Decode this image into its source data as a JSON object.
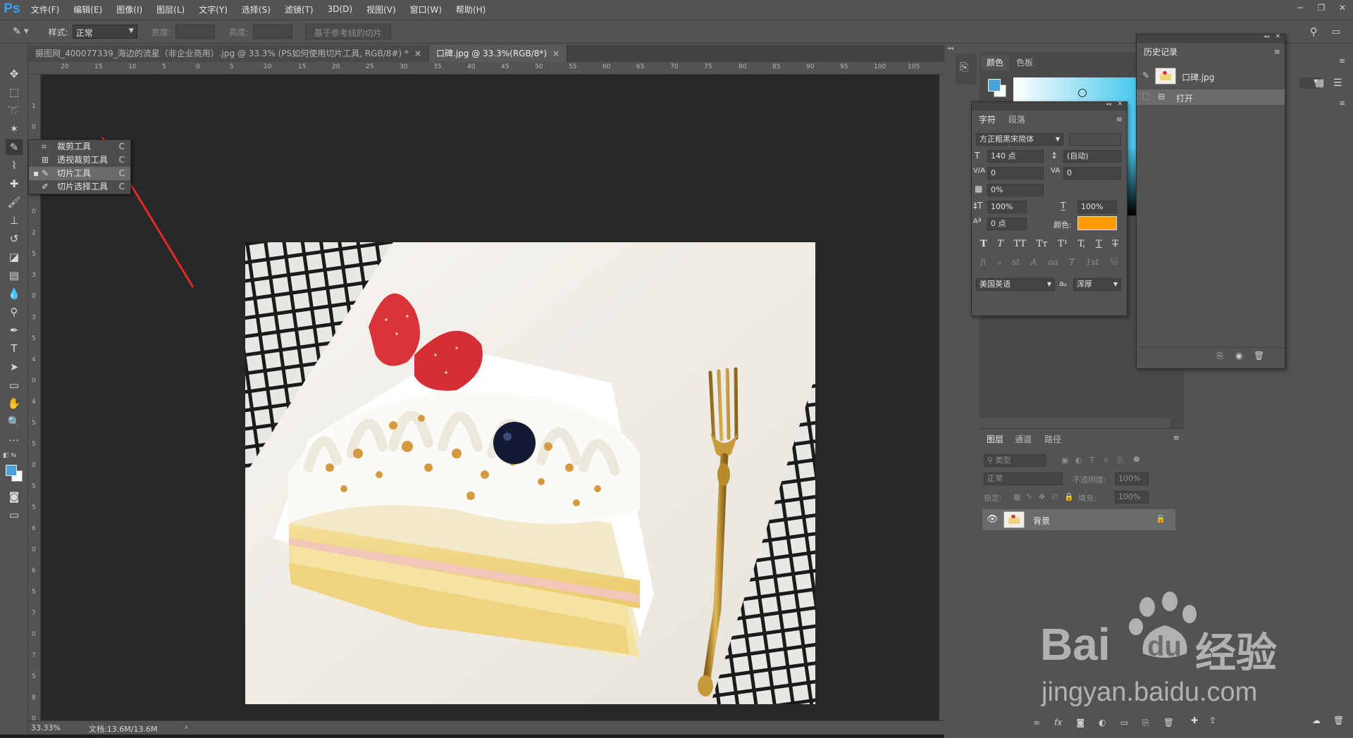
{
  "app": {
    "logo": "Ps"
  },
  "menu": [
    "文件(F)",
    "编辑(E)",
    "图像(I)",
    "图层(L)",
    "文字(Y)",
    "选择(S)",
    "滤镜(T)",
    "3D(D)",
    "视图(V)",
    "窗口(W)",
    "帮助(H)"
  ],
  "options": {
    "style_label": "样式:",
    "style_value": "正常",
    "width_label": "宽度:",
    "height_label": "高度:",
    "guide_slices_button": "基于参考线的切片"
  },
  "tabs": [
    {
      "label": "摄图网_400077339_海边的流星（非企业商用）.jpg @ 33.3% (PS如何使用切片工具, RGB/8#) *",
      "close": "×"
    },
    {
      "label": "口碑.jpg @ 33.3%(RGB/8*)",
      "close": "×"
    }
  ],
  "ruler_top": [
    "20",
    "15",
    "10",
    "5",
    "0",
    "5",
    "10",
    "15",
    "20",
    "25",
    "30",
    "35",
    "40",
    "45",
    "50",
    "55",
    "60",
    "65",
    "70",
    "75",
    "80",
    "85",
    "90",
    "95",
    "100",
    "105"
  ],
  "ruler_left": [
    "1",
    "0",
    "1",
    "5",
    "2",
    "0",
    "2",
    "5",
    "3",
    "0",
    "3",
    "5",
    "4",
    "0",
    "4",
    "5",
    "5",
    "0",
    "5",
    "5",
    "6",
    "0",
    "6",
    "5",
    "7",
    "0",
    "7",
    "5",
    "8",
    "0"
  ],
  "flyout": [
    {
      "label": "裁剪工具",
      "key": "C",
      "icon": "crop-icon"
    },
    {
      "label": "透视裁剪工具",
      "key": "C",
      "icon": "perspective-crop-icon"
    },
    {
      "label": "切片工具",
      "key": "C",
      "icon": "slice-icon",
      "selected": true
    },
    {
      "label": "切片选择工具",
      "key": "C",
      "icon": "slice-select-icon"
    }
  ],
  "status": {
    "zoom": "33.33%",
    "doc": "文档:13.6M/13.6M",
    "arrow": "›"
  },
  "color_panel": {
    "tabs": [
      "颜色",
      "色板"
    ]
  },
  "character_panel": {
    "tabs": [
      "字符",
      "段落"
    ],
    "font_family": "方正粗黑宋简体",
    "font_size": "140 点",
    "leading": "(自动)",
    "kerning": "0",
    "tracking": "0",
    "tsume": "0%",
    "vertical_scale": "100%",
    "horizontal_scale": "100%",
    "baseline_shift": "0 点",
    "color_label": "颜色:",
    "color": "#ff9900",
    "language": "美国英语",
    "aa_label": "aₐ",
    "antialias": "浑厚",
    "style_buttons": [
      "T",
      "T",
      "TT",
      "Tт",
      "T¹",
      "T,",
      "T",
      "T"
    ],
    "opentype_buttons": [
      "fi",
      "ℴ",
      "st",
      "A",
      "aa",
      "T",
      "1st",
      "½"
    ]
  },
  "history_panel": {
    "title": "历史记录",
    "snapshot": "口碑.jpg",
    "steps": [
      "打开"
    ]
  },
  "layers_panel": {
    "tabs": [
      "图层",
      "通道",
      "路径"
    ],
    "filter_placeholder": "类型",
    "blend_mode": "正常",
    "opacity_label": "不透明度:",
    "opacity": "100%",
    "lock_label": "锁定:",
    "fill_label": "填充:",
    "fill": "100%",
    "layers": [
      {
        "name": "背景",
        "locked": true,
        "visible": true
      }
    ]
  },
  "watermark": {
    "brand_a": "Bai",
    "brand_b": "du",
    "brand_c": "经验",
    "url": "jingyan.baidu.com"
  }
}
